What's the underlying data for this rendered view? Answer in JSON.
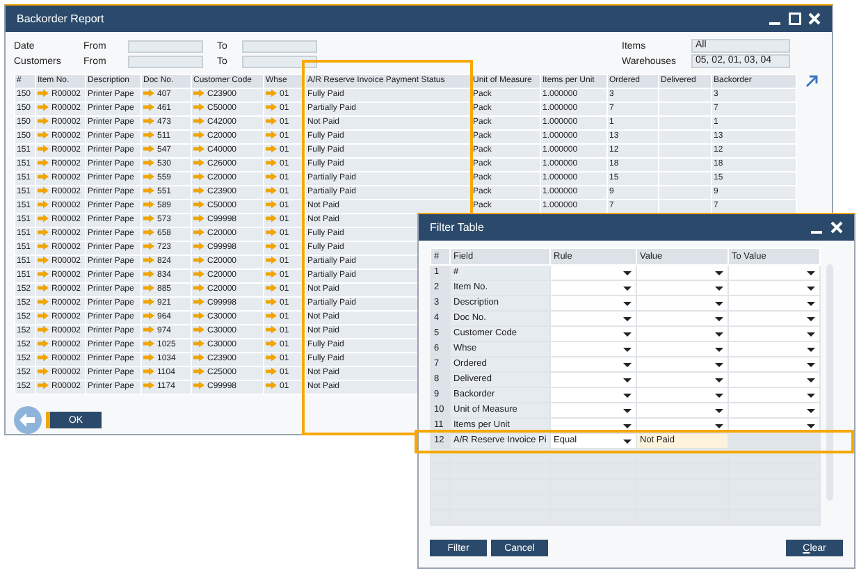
{
  "main_window": {
    "title": "Backorder Report",
    "criteria": [
      {
        "label": "Date",
        "from_label": "From",
        "to_label": "To"
      },
      {
        "label": "Customers",
        "from_label": "From",
        "to_label": "To"
      }
    ],
    "selections": [
      {
        "label": "Items",
        "value": "All"
      },
      {
        "label": "Warehouses",
        "value": "05, 02, 01, 03, 04"
      }
    ],
    "table": {
      "columns": [
        {
          "label": "#",
          "highlighted": false
        },
        {
          "label": "Item No.",
          "highlighted": false
        },
        {
          "label": "Description",
          "highlighted": false
        },
        {
          "label": "Doc No.",
          "highlighted": false
        },
        {
          "label": "Customer Code",
          "highlighted": false
        },
        {
          "label": "Whse",
          "highlighted": false
        },
        {
          "label": "A/R Reserve Invoice Payment Status",
          "highlighted": true
        },
        {
          "label": "Unit of Measure",
          "highlighted": false
        },
        {
          "label": "Items per Unit",
          "highlighted": false
        },
        {
          "label": "Ordered",
          "highlighted": false
        },
        {
          "label": "Delivered",
          "highlighted": false
        },
        {
          "label": "Backorder",
          "highlighted": false
        }
      ],
      "rows": [
        {
          "num": "150",
          "item_no": "R00002",
          "description": "Printer Pape",
          "doc_no": "407",
          "customer_code": "C23900",
          "whse": "01",
          "status": "Fully Paid",
          "unit": "Pack",
          "items_per_unit": "1.000000",
          "ordered": "3",
          "backorder": "3"
        },
        {
          "num": "150",
          "item_no": "R00002",
          "description": "Printer Pape",
          "doc_no": "461",
          "customer_code": "C50000",
          "whse": "01",
          "status": "Partially Paid",
          "unit": "Pack",
          "items_per_unit": "1.000000",
          "ordered": "7",
          "backorder": "7"
        },
        {
          "num": "150",
          "item_no": "R00002",
          "description": "Printer Pape",
          "doc_no": "473",
          "customer_code": "C42000",
          "whse": "01",
          "status": "Not Paid",
          "unit": "Pack",
          "items_per_unit": "1.000000",
          "ordered": "1",
          "backorder": "1"
        },
        {
          "num": "150",
          "item_no": "R00002",
          "description": "Printer Pape",
          "doc_no": "511",
          "customer_code": "C20000",
          "whse": "01",
          "status": "Fully Paid",
          "unit": "Pack",
          "items_per_unit": "1.000000",
          "ordered": "13",
          "backorder": "13"
        },
        {
          "num": "151",
          "item_no": "R00002",
          "description": "Printer Pape",
          "doc_no": "547",
          "customer_code": "C40000",
          "whse": "01",
          "status": "Fully Paid",
          "unit": "Pack",
          "items_per_unit": "1.000000",
          "ordered": "12",
          "backorder": "12"
        },
        {
          "num": "151",
          "item_no": "R00002",
          "description": "Printer Pape",
          "doc_no": "530",
          "customer_code": "C26000",
          "whse": "01",
          "status": "Fully Paid",
          "unit": "Pack",
          "items_per_unit": "1.000000",
          "ordered": "18",
          "backorder": "18"
        },
        {
          "num": "151",
          "item_no": "R00002",
          "description": "Printer Pape",
          "doc_no": "559",
          "customer_code": "C20000",
          "whse": "01",
          "status": "Partially Paid",
          "unit": "Pack",
          "items_per_unit": "1.000000",
          "ordered": "15",
          "backorder": "15"
        },
        {
          "num": "151",
          "item_no": "R00002",
          "description": "Printer Pape",
          "doc_no": "551",
          "customer_code": "C23900",
          "whse": "01",
          "status": "Partially Paid",
          "unit": "Pack",
          "items_per_unit": "1.000000",
          "ordered": "9",
          "backorder": "9"
        },
        {
          "num": "151",
          "item_no": "R00002",
          "description": "Printer Pape",
          "doc_no": "589",
          "customer_code": "C50000",
          "whse": "01",
          "status": "Not Paid",
          "unit": "Pack",
          "items_per_unit": "1.000000",
          "ordered": "7",
          "backorder": "7"
        },
        {
          "num": "151",
          "item_no": "R00002",
          "description": "Printer Pape",
          "doc_no": "573",
          "customer_code": "C99998",
          "whse": "01",
          "status": "Not Paid"
        },
        {
          "num": "151",
          "item_no": "R00002",
          "description": "Printer Pape",
          "doc_no": "658",
          "customer_code": "C20000",
          "whse": "01",
          "status": "Fully Paid"
        },
        {
          "num": "151",
          "item_no": "R00002",
          "description": "Printer Pape",
          "doc_no": "723",
          "customer_code": "C99998",
          "whse": "01",
          "status": "Fully Paid"
        },
        {
          "num": "151",
          "item_no": "R00002",
          "description": "Printer Pape",
          "doc_no": "824",
          "customer_code": "C20000",
          "whse": "01",
          "status": "Partially Paid"
        },
        {
          "num": "151",
          "item_no": "R00002",
          "description": "Printer Pape",
          "doc_no": "834",
          "customer_code": "C20000",
          "whse": "01",
          "status": "Partially Paid"
        },
        {
          "num": "152",
          "item_no": "R00002",
          "description": "Printer Pape",
          "doc_no": "885",
          "customer_code": "C20000",
          "whse": "01",
          "status": "Not Paid"
        },
        {
          "num": "152",
          "item_no": "R00002",
          "description": "Printer Pape",
          "doc_no": "921",
          "customer_code": "C99998",
          "whse": "01",
          "status": "Partially Paid"
        },
        {
          "num": "152",
          "item_no": "R00002",
          "description": "Printer Pape",
          "doc_no": "964",
          "customer_code": "C30000",
          "whse": "01",
          "status": "Not Paid"
        },
        {
          "num": "152",
          "item_no": "R00002",
          "description": "Printer Pape",
          "doc_no": "974",
          "customer_code": "C30000",
          "whse": "01",
          "status": "Not Paid"
        },
        {
          "num": "152",
          "item_no": "R00002",
          "description": "Printer Pape",
          "doc_no": "1025",
          "customer_code": "C30000",
          "whse": "01",
          "status": "Fully Paid"
        },
        {
          "num": "152",
          "item_no": "R00002",
          "description": "Printer Pape",
          "doc_no": "1034",
          "customer_code": "C23900",
          "whse": "01",
          "status": "Fully Paid"
        },
        {
          "num": "152",
          "item_no": "R00002",
          "description": "Printer Pape",
          "doc_no": "1104",
          "customer_code": "C25000",
          "whse": "01",
          "status": "Not Paid"
        },
        {
          "num": "152",
          "item_no": "R00002",
          "description": "Printer Pape",
          "doc_no": "1174",
          "customer_code": "C99998",
          "whse": "01",
          "status": "Not Paid"
        }
      ]
    },
    "buttons": [
      {
        "kind": "back"
      },
      {
        "kind": "text",
        "label": "OK"
      }
    ]
  },
  "filter_window": {
    "title": "Filter Table",
    "columns": [
      "#",
      "Field",
      "Rule",
      "Value",
      "To Value"
    ],
    "rows": [
      {
        "num": "1",
        "field": "#",
        "highlighted": false
      },
      {
        "num": "2",
        "field": "Item No.",
        "highlighted": false
      },
      {
        "num": "3",
        "field": "Description",
        "highlighted": false
      },
      {
        "num": "4",
        "field": "Doc No.",
        "highlighted": false
      },
      {
        "num": "5",
        "field": "Customer Code",
        "highlighted": false
      },
      {
        "num": "6",
        "field": "Whse",
        "highlighted": false
      },
      {
        "num": "7",
        "field": "Ordered",
        "highlighted": false
      },
      {
        "num": "8",
        "field": "Delivered",
        "highlighted": false
      },
      {
        "num": "9",
        "field": "Backorder",
        "highlighted": false
      },
      {
        "num": "10",
        "field": "Unit of Measure",
        "highlighted": false
      },
      {
        "num": "11",
        "field": "Items per Unit",
        "highlighted": false
      },
      {
        "num": "12",
        "field": "A/R Reserve Invoice Pi",
        "rule": "Equal",
        "value": "Not Paid",
        "highlighted": true
      }
    ],
    "buttons": [
      "Filter",
      "Cancel",
      "Clear"
    ]
  }
}
